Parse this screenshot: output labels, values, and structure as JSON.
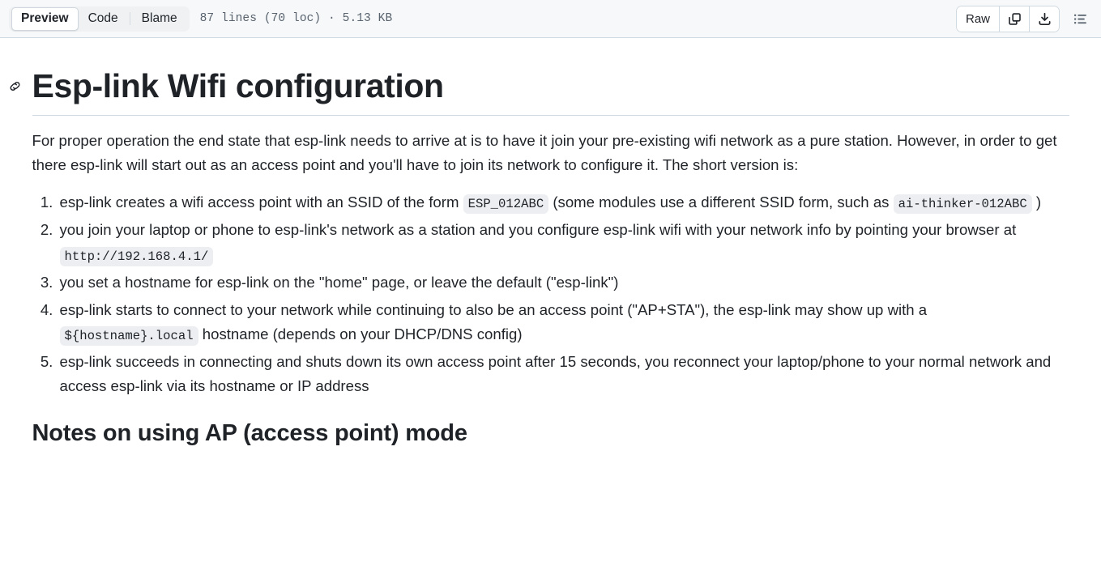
{
  "header": {
    "tabs": [
      {
        "label": "Preview",
        "selected": true
      },
      {
        "label": "Code",
        "selected": false
      },
      {
        "label": "Blame",
        "selected": false
      }
    ],
    "file_meta": "87 lines (70 loc) · 5.13 KB",
    "raw_label": "Raw",
    "copy_icon": "copy-icon",
    "download_icon": "download-icon",
    "outline_icon": "outline-list-icon",
    "bg_color": "#f6f8fa",
    "border_color": "#d1d9e0"
  },
  "document": {
    "title": "Esp-link Wifi configuration",
    "anchor_icon": "link-anchor-icon",
    "intro": "For proper operation the end state that esp-link needs to arrive at is to have it join your pre-existing wifi network as a pure station. However, in order to get there esp-link will start out as an access point and you'll have to join its network to configure it. The short version is:",
    "steps": [
      {
        "parts": [
          {
            "type": "text",
            "value": "esp-link creates a wifi access point with an SSID of the form "
          },
          {
            "type": "code",
            "value": "ESP_012ABC"
          },
          {
            "type": "text",
            "value": " (some modules use a different SSID form, such as "
          },
          {
            "type": "code",
            "value": "ai-thinker-012ABC"
          },
          {
            "type": "text",
            "value": " )"
          }
        ]
      },
      {
        "parts": [
          {
            "type": "text",
            "value": "you join your laptop or phone to esp-link's network as a station and you configure esp-link wifi with your network info by pointing your browser at "
          },
          {
            "type": "code",
            "value": "http://192.168.4.1/"
          }
        ]
      },
      {
        "parts": [
          {
            "type": "text",
            "value": "you set a hostname for esp-link on the \"home\" page, or leave the default (\"esp-link\")"
          }
        ]
      },
      {
        "parts": [
          {
            "type": "text",
            "value": "esp-link starts to connect to your network while continuing to also be an access point (\"AP+STA\"), the esp-link may show up with a "
          },
          {
            "type": "code",
            "value": "${hostname}.local"
          },
          {
            "type": "text",
            "value": " hostname (depends on your DHCP/DNS config)"
          }
        ]
      },
      {
        "parts": [
          {
            "type": "text",
            "value": "esp-link succeeds in connecting and shuts down its own access point after 15 seconds, you reconnect your laptop/phone to your normal network and access esp-link via its hostname or IP address"
          }
        ]
      }
    ],
    "section_heading": "Notes on using AP (access point) mode"
  }
}
